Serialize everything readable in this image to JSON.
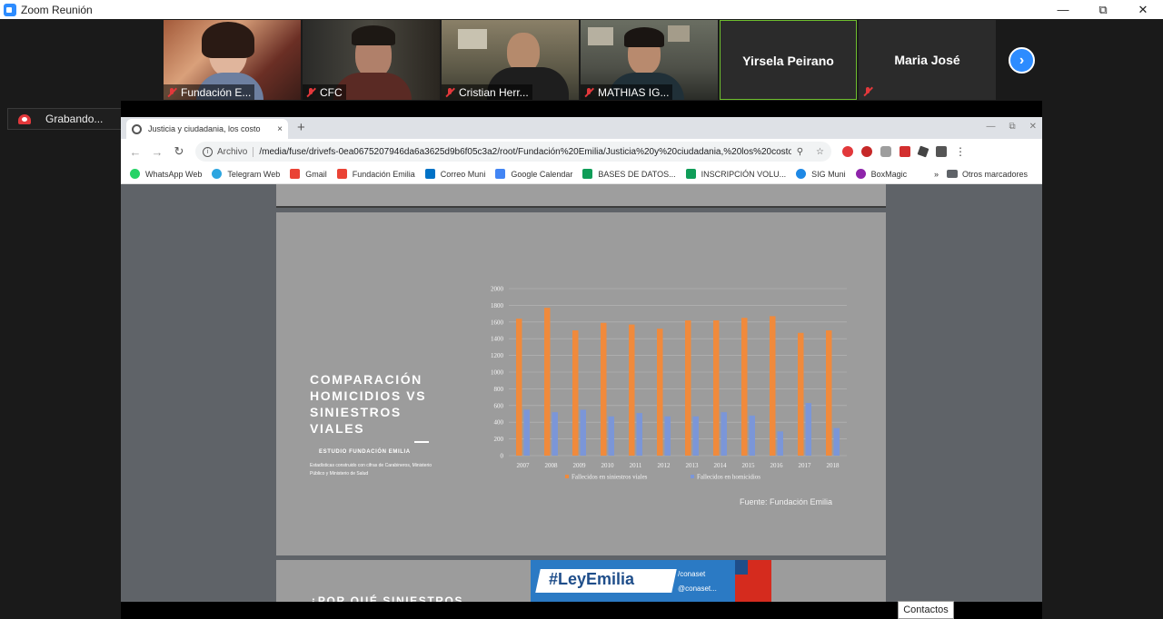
{
  "window": {
    "title": "Zoom Reunión",
    "minimize": "—",
    "restore": "⧉",
    "close": "✕"
  },
  "participants": [
    {
      "name": "Fundación E...",
      "muted": true,
      "video": true
    },
    {
      "name": "CFC",
      "muted": true,
      "video": true
    },
    {
      "name": "Cristian Herr...",
      "muted": true,
      "video": true
    },
    {
      "name": "MATHIAS IG...",
      "muted": true,
      "video": true
    },
    {
      "name": "Yirsela Peirano",
      "muted": false,
      "video": false,
      "active_speaker": true
    },
    {
      "name": "Maria José",
      "muted": true,
      "video": false
    }
  ],
  "gallery_next_icon": "chevron-right",
  "recording": {
    "label": "Grabando..."
  },
  "browser": {
    "tab_title": "Justicia y ciudadania, los costo",
    "tab_close": "×",
    "new_tab": "+",
    "nav": {
      "back": "←",
      "forward": "→",
      "reload": "↻"
    },
    "url_prefix": "Archivo",
    "url": "/media/fuse/drivefs-0ea0675207946da6a3625d9b6f05c3a2/root/Fundación%20Emilia/Justicia%20y%20ciudadania,%20los%20costo...",
    "bookmarks": [
      {
        "label": "WhatsApp Web",
        "color": "#25d366"
      },
      {
        "label": "Telegram Web",
        "color": "#2ca5e0"
      },
      {
        "label": "Gmail",
        "color": "#ea4335"
      },
      {
        "label": "Fundación Emilia",
        "color": "#ea4335"
      },
      {
        "label": "Correo Muni",
        "color": "#0072c6"
      },
      {
        "label": "Google Calendar",
        "color": "#4285f4"
      },
      {
        "label": "BASES DE DATOS...",
        "color": "#0f9d58"
      },
      {
        "label": "INSCRIPCIÓN VOLU...",
        "color": "#0f9d58"
      },
      {
        "label": "SIG Muni",
        "color": "#1e88e5"
      },
      {
        "label": "BoxMagic",
        "color": "#8e24aa"
      }
    ],
    "bookmarks_more": "»",
    "other_bookmarks": "Otros marcadores"
  },
  "slide": {
    "title": "COMPARACIÓN HOMICIDIOS VS SINIESTROS VIALES",
    "subtitle": "ESTUDIO FUNDACIÓN EMILIA",
    "description": "Estadísticas construido con cifras de Carabineros, Ministerio Público y Ministerio de Salud",
    "source": "Fuente: Fundación Emilia"
  },
  "next_slide": {
    "title": "¿POR QUÉ SINIESTROS",
    "banner_tag": "#LeyEmilia",
    "banner_fb": "/conaset",
    "banner_tw": "@conaset..."
  },
  "chart_data": {
    "type": "bar",
    "categories": [
      "2007",
      "2008",
      "2009",
      "2010",
      "2011",
      "2012",
      "2013",
      "2014",
      "2015",
      "2016",
      "2017",
      "2018"
    ],
    "series": [
      {
        "name": "Fallecidos en siniestros viales",
        "color": "#f08a3c",
        "values": [
          1640,
          1770,
          1500,
          1590,
          1570,
          1520,
          1620,
          1620,
          1650,
          1670,
          1470,
          1500
        ]
      },
      {
        "name": "Fallecidos en homicidios",
        "color": "#7b96d8",
        "values": [
          550,
          520,
          550,
          470,
          510,
          470,
          470,
          520,
          480,
          290,
          630,
          330
        ]
      }
    ],
    "ylim": [
      0,
      2000
    ],
    "yticks": [
      "0",
      "200",
      "400",
      "600",
      "800",
      "1000",
      "1200",
      "1400",
      "1600",
      "1800",
      "2000"
    ],
    "grid": true,
    "legend": "bottom"
  },
  "contacts": {
    "label": "Contactos"
  }
}
